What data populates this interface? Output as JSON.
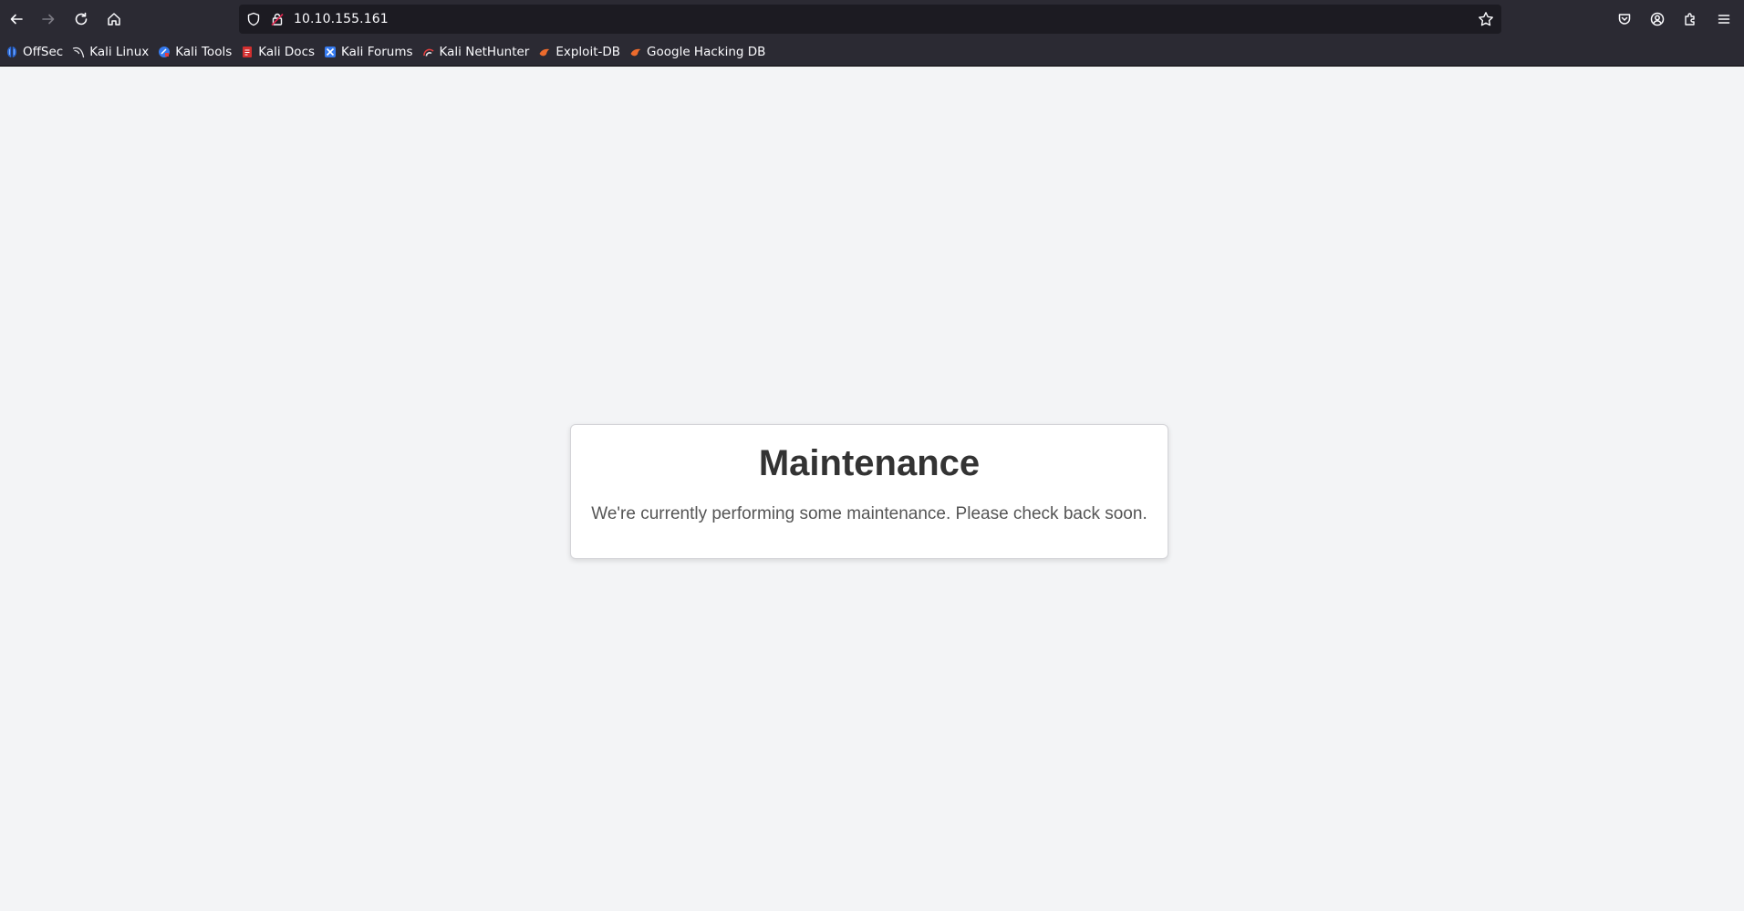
{
  "browser": {
    "url": "10.10.155.161",
    "icons": {
      "back": "arrow-left-icon",
      "forward": "arrow-right-icon",
      "reload": "reload-icon",
      "home": "home-icon",
      "tracking": "shield-icon",
      "insecure": "lock-insecure-icon",
      "bookmark_star": "star-icon",
      "pocket": "pocket-icon",
      "account": "account-icon",
      "extensions": "extensions-icon",
      "menu": "hamburger-menu-icon"
    },
    "bookmarks": [
      {
        "label": "OffSec",
        "icon": "offsec-icon"
      },
      {
        "label": "Kali Linux",
        "icon": "kali-dragon-icon"
      },
      {
        "label": "Kali Tools",
        "icon": "kali-tools-icon"
      },
      {
        "label": "Kali Docs",
        "icon": "kali-docs-icon"
      },
      {
        "label": "Kali Forums",
        "icon": "kali-forums-icon"
      },
      {
        "label": "Kali NetHunter",
        "icon": "nethunter-icon"
      },
      {
        "label": "Exploit-DB",
        "icon": "exploit-db-icon"
      },
      {
        "label": "Google Hacking DB",
        "icon": "ghdb-icon"
      }
    ]
  },
  "page": {
    "title": "Maintenance",
    "message": "We're currently performing some maintenance. Please check back soon."
  },
  "colors": {
    "chrome": "#2b2a33",
    "urlbar": "#1c1b22",
    "page_bg": "#f3f4f6",
    "card_bg": "#ffffff",
    "title": "#333333",
    "message": "#555555"
  }
}
